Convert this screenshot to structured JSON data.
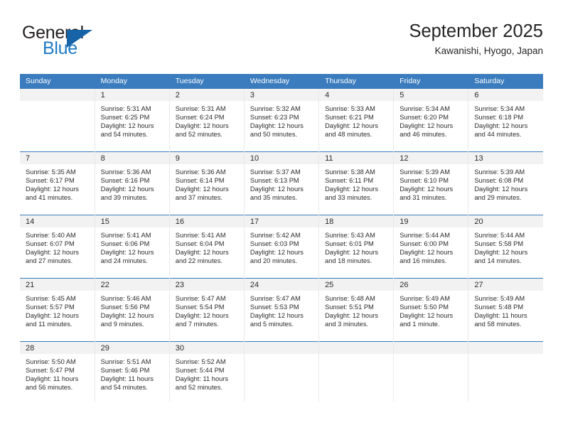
{
  "logo": {
    "word_top": "General",
    "word_bottom": "Blue",
    "triangle_color": "#1763a8",
    "blue_color": "#1f7ac4"
  },
  "header": {
    "title": "September 2025",
    "subtitle": "Kawanishi, Hyogo, Japan"
  },
  "theme": {
    "header_blue": "#3b7cbe",
    "daynum_band": "#f2f2f2",
    "grid_line": "#e8e8e8",
    "text": "#2b2b2b"
  },
  "weekdays": [
    "Sunday",
    "Monday",
    "Tuesday",
    "Wednesday",
    "Thursday",
    "Friday",
    "Saturday"
  ],
  "weeks": [
    [
      {
        "day": "",
        "sunrise": "",
        "sunset": "",
        "daylight_line1": "",
        "daylight_line2": ""
      },
      {
        "day": "1",
        "sunrise": "Sunrise: 5:31 AM",
        "sunset": "Sunset: 6:25 PM",
        "daylight_line1": "Daylight: 12 hours",
        "daylight_line2": "and 54 minutes."
      },
      {
        "day": "2",
        "sunrise": "Sunrise: 5:31 AM",
        "sunset": "Sunset: 6:24 PM",
        "daylight_line1": "Daylight: 12 hours",
        "daylight_line2": "and 52 minutes."
      },
      {
        "day": "3",
        "sunrise": "Sunrise: 5:32 AM",
        "sunset": "Sunset: 6:23 PM",
        "daylight_line1": "Daylight: 12 hours",
        "daylight_line2": "and 50 minutes."
      },
      {
        "day": "4",
        "sunrise": "Sunrise: 5:33 AM",
        "sunset": "Sunset: 6:21 PM",
        "daylight_line1": "Daylight: 12 hours",
        "daylight_line2": "and 48 minutes."
      },
      {
        "day": "5",
        "sunrise": "Sunrise: 5:34 AM",
        "sunset": "Sunset: 6:20 PM",
        "daylight_line1": "Daylight: 12 hours",
        "daylight_line2": "and 46 minutes."
      },
      {
        "day": "6",
        "sunrise": "Sunrise: 5:34 AM",
        "sunset": "Sunset: 6:18 PM",
        "daylight_line1": "Daylight: 12 hours",
        "daylight_line2": "and 44 minutes."
      }
    ],
    [
      {
        "day": "7",
        "sunrise": "Sunrise: 5:35 AM",
        "sunset": "Sunset: 6:17 PM",
        "daylight_line1": "Daylight: 12 hours",
        "daylight_line2": "and 41 minutes."
      },
      {
        "day": "8",
        "sunrise": "Sunrise: 5:36 AM",
        "sunset": "Sunset: 6:16 PM",
        "daylight_line1": "Daylight: 12 hours",
        "daylight_line2": "and 39 minutes."
      },
      {
        "day": "9",
        "sunrise": "Sunrise: 5:36 AM",
        "sunset": "Sunset: 6:14 PM",
        "daylight_line1": "Daylight: 12 hours",
        "daylight_line2": "and 37 minutes."
      },
      {
        "day": "10",
        "sunrise": "Sunrise: 5:37 AM",
        "sunset": "Sunset: 6:13 PM",
        "daylight_line1": "Daylight: 12 hours",
        "daylight_line2": "and 35 minutes."
      },
      {
        "day": "11",
        "sunrise": "Sunrise: 5:38 AM",
        "sunset": "Sunset: 6:11 PM",
        "daylight_line1": "Daylight: 12 hours",
        "daylight_line2": "and 33 minutes."
      },
      {
        "day": "12",
        "sunrise": "Sunrise: 5:39 AM",
        "sunset": "Sunset: 6:10 PM",
        "daylight_line1": "Daylight: 12 hours",
        "daylight_line2": "and 31 minutes."
      },
      {
        "day": "13",
        "sunrise": "Sunrise: 5:39 AM",
        "sunset": "Sunset: 6:08 PM",
        "daylight_line1": "Daylight: 12 hours",
        "daylight_line2": "and 29 minutes."
      }
    ],
    [
      {
        "day": "14",
        "sunrise": "Sunrise: 5:40 AM",
        "sunset": "Sunset: 6:07 PM",
        "daylight_line1": "Daylight: 12 hours",
        "daylight_line2": "and 27 minutes."
      },
      {
        "day": "15",
        "sunrise": "Sunrise: 5:41 AM",
        "sunset": "Sunset: 6:06 PM",
        "daylight_line1": "Daylight: 12 hours",
        "daylight_line2": "and 24 minutes."
      },
      {
        "day": "16",
        "sunrise": "Sunrise: 5:41 AM",
        "sunset": "Sunset: 6:04 PM",
        "daylight_line1": "Daylight: 12 hours",
        "daylight_line2": "and 22 minutes."
      },
      {
        "day": "17",
        "sunrise": "Sunrise: 5:42 AM",
        "sunset": "Sunset: 6:03 PM",
        "daylight_line1": "Daylight: 12 hours",
        "daylight_line2": "and 20 minutes."
      },
      {
        "day": "18",
        "sunrise": "Sunrise: 5:43 AM",
        "sunset": "Sunset: 6:01 PM",
        "daylight_line1": "Daylight: 12 hours",
        "daylight_line2": "and 18 minutes."
      },
      {
        "day": "19",
        "sunrise": "Sunrise: 5:44 AM",
        "sunset": "Sunset: 6:00 PM",
        "daylight_line1": "Daylight: 12 hours",
        "daylight_line2": "and 16 minutes."
      },
      {
        "day": "20",
        "sunrise": "Sunrise: 5:44 AM",
        "sunset": "Sunset: 5:58 PM",
        "daylight_line1": "Daylight: 12 hours",
        "daylight_line2": "and 14 minutes."
      }
    ],
    [
      {
        "day": "21",
        "sunrise": "Sunrise: 5:45 AM",
        "sunset": "Sunset: 5:57 PM",
        "daylight_line1": "Daylight: 12 hours",
        "daylight_line2": "and 11 minutes."
      },
      {
        "day": "22",
        "sunrise": "Sunrise: 5:46 AM",
        "sunset": "Sunset: 5:56 PM",
        "daylight_line1": "Daylight: 12 hours",
        "daylight_line2": "and 9 minutes."
      },
      {
        "day": "23",
        "sunrise": "Sunrise: 5:47 AM",
        "sunset": "Sunset: 5:54 PM",
        "daylight_line1": "Daylight: 12 hours",
        "daylight_line2": "and 7 minutes."
      },
      {
        "day": "24",
        "sunrise": "Sunrise: 5:47 AM",
        "sunset": "Sunset: 5:53 PM",
        "daylight_line1": "Daylight: 12 hours",
        "daylight_line2": "and 5 minutes."
      },
      {
        "day": "25",
        "sunrise": "Sunrise: 5:48 AM",
        "sunset": "Sunset: 5:51 PM",
        "daylight_line1": "Daylight: 12 hours",
        "daylight_line2": "and 3 minutes."
      },
      {
        "day": "26",
        "sunrise": "Sunrise: 5:49 AM",
        "sunset": "Sunset: 5:50 PM",
        "daylight_line1": "Daylight: 12 hours",
        "daylight_line2": "and 1 minute."
      },
      {
        "day": "27",
        "sunrise": "Sunrise: 5:49 AM",
        "sunset": "Sunset: 5:48 PM",
        "daylight_line1": "Daylight: 11 hours",
        "daylight_line2": "and 58 minutes."
      }
    ],
    [
      {
        "day": "28",
        "sunrise": "Sunrise: 5:50 AM",
        "sunset": "Sunset: 5:47 PM",
        "daylight_line1": "Daylight: 11 hours",
        "daylight_line2": "and 56 minutes."
      },
      {
        "day": "29",
        "sunrise": "Sunrise: 5:51 AM",
        "sunset": "Sunset: 5:46 PM",
        "daylight_line1": "Daylight: 11 hours",
        "daylight_line2": "and 54 minutes."
      },
      {
        "day": "30",
        "sunrise": "Sunrise: 5:52 AM",
        "sunset": "Sunset: 5:44 PM",
        "daylight_line1": "Daylight: 11 hours",
        "daylight_line2": "and 52 minutes."
      },
      {
        "day": "",
        "sunrise": "",
        "sunset": "",
        "daylight_line1": "",
        "daylight_line2": ""
      },
      {
        "day": "",
        "sunrise": "",
        "sunset": "",
        "daylight_line1": "",
        "daylight_line2": ""
      },
      {
        "day": "",
        "sunrise": "",
        "sunset": "",
        "daylight_line1": "",
        "daylight_line2": ""
      },
      {
        "day": "",
        "sunrise": "",
        "sunset": "",
        "daylight_line1": "",
        "daylight_line2": ""
      }
    ]
  ]
}
